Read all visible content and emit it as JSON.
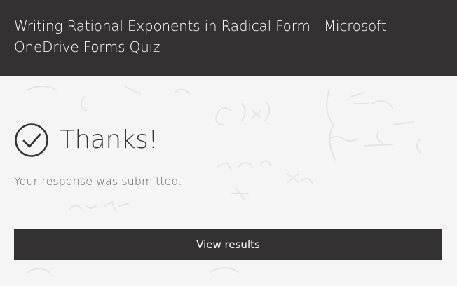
{
  "header": {
    "title": "Writing Rational Exponents in Radical Form - Microsoft OneDrive Forms Quiz"
  },
  "confirmation": {
    "icon": "check-circle-icon",
    "heading": "Thanks!",
    "message": "Your response was submitted."
  },
  "actions": {
    "view_results_label": "View results"
  },
  "colors": {
    "header_bg": "#333132",
    "button_bg": "#333132",
    "page_bg": "#f5f5f5",
    "heading_text": "#333333",
    "message_text": "#666666"
  }
}
